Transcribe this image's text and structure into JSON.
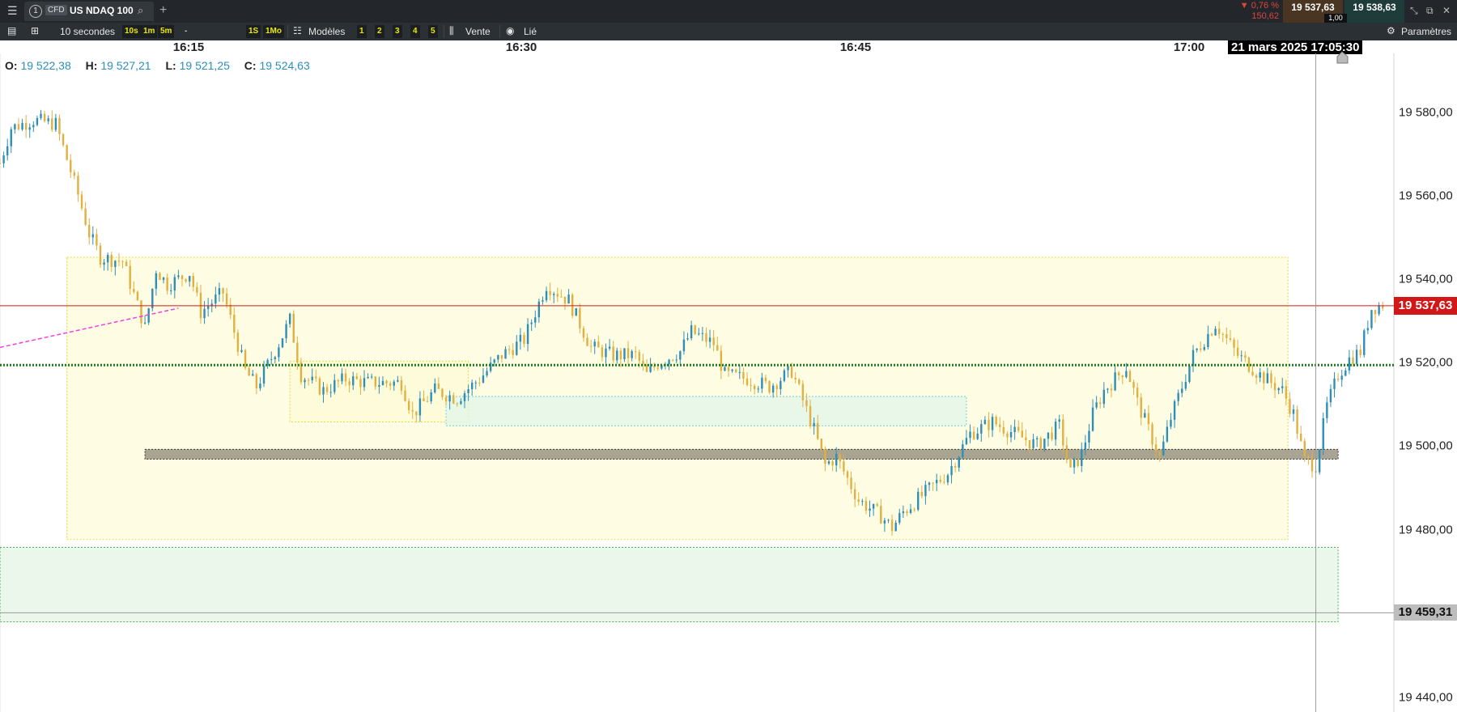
{
  "topbar": {
    "menu_icon": "hamburger-icon",
    "tab_number": "1",
    "tab_badge": "CFD",
    "instrument": "US NDAQ 100",
    "search_icon": "search-icon",
    "add_icon": "plus-icon",
    "change_pct": "▼ 0,76 %",
    "change_abs": "150,62",
    "bid": "19 537,63",
    "ask": "19 538,63",
    "spread": "1,00",
    "window_icons": [
      "minimize-icon",
      "popout-icon",
      "close-icon"
    ]
  },
  "toolbar": {
    "timeframe": "10 secondes",
    "quick_intervals": [
      "10s",
      "1m",
      "5m"
    ],
    "dash": "-",
    "range_buttons": [
      "1S",
      "1Mo"
    ],
    "templates_label": "Modèles",
    "template_numbers": [
      "1",
      "2",
      "3",
      "4",
      "5"
    ],
    "sell_label": "Vente",
    "linked_label": "Lié",
    "settings_label": "Paramètres"
  },
  "time_axis": {
    "ticks": [
      "16:15",
      "16:30",
      "16:45",
      "17:00"
    ],
    "cursor_label": "21 mars 2025 17:05:30"
  },
  "ohlc": {
    "O": "19 522,38",
    "H": "19 527,21",
    "L": "19 521,25",
    "C": "19 524,63"
  },
  "colors": {
    "up": "#2d8fb8",
    "down": "#e0b040",
    "current_price_bg": "#d01818",
    "dotted_level": "#1e7a1e",
    "yellow_zone": "#fefbd8",
    "green_zone": "#e6f4e6"
  },
  "price_axis": {
    "labels": [
      "19 580,00",
      "19 560,00",
      "19 540,00",
      "19 520,00",
      "19 500,00",
      "19 480,00",
      "19 440,00"
    ],
    "current_price": "19 537,63",
    "hover_price": "19 459,31"
  },
  "chart_data": {
    "type": "candlestick",
    "x_start": "16:06:30",
    "x_end": "17:09:00",
    "ylim": [
      19434,
      19602
    ],
    "current_price": 19537.63,
    "hover_price": 19459.31,
    "dotted_level": 19522.5,
    "zones": [
      {
        "kind": "yellow",
        "from": "16:09:30",
        "to": "17:04:15",
        "low": 19478,
        "high": 19550
      },
      {
        "kind": "yellow",
        "from": "16:19:30",
        "to": "16:27:30",
        "low": 19508,
        "high": 19523.5
      },
      {
        "kind": "cyan",
        "from": "16:26:30",
        "to": "16:49:50",
        "low": 19507,
        "high": 19514.5
      },
      {
        "kind": "grey",
        "from": "16:13:00",
        "to": "17:06:30",
        "low": 19498.5,
        "high": 19501
      },
      {
        "kind": "green",
        "from": "16:06:30",
        "to": "17:06:30",
        "low": 19457,
        "high": 19476
      }
    ],
    "trend_line": {
      "from": [
        "16:06:30",
        19527
      ],
      "to": [
        "16:14:30",
        19537
      ]
    },
    "path": [
      [
        "16:06:30",
        19574
      ],
      [
        "16:07:00",
        19583
      ],
      [
        "16:08:00",
        19585
      ],
      [
        "16:09:00",
        19584
      ],
      [
        "16:10:00",
        19566
      ],
      [
        "16:10:30",
        19556
      ],
      [
        "16:11:00",
        19550
      ],
      [
        "16:12:00",
        19549
      ],
      [
        "16:13:00",
        19532
      ],
      [
        "16:13:30",
        19547
      ],
      [
        "16:14:00",
        19543
      ],
      [
        "16:15:00",
        19546
      ],
      [
        "16:15:30",
        19536
      ],
      [
        "16:16:30",
        19541
      ],
      [
        "16:17:30",
        19521
      ],
      [
        "16:18:00",
        19517
      ],
      [
        "16:19:00",
        19528
      ],
      [
        "16:19:30",
        19534
      ],
      [
        "16:20:00",
        19520
      ],
      [
        "16:21:00",
        19516
      ],
      [
        "16:22:00",
        19519
      ],
      [
        "16:23:00",
        19518
      ],
      [
        "16:24:30",
        19518
      ],
      [
        "16:25:00",
        19510
      ],
      [
        "16:26:00",
        19516
      ],
      [
        "16:27:00",
        19514
      ],
      [
        "16:28:00",
        19519
      ],
      [
        "16:29:00",
        19525
      ],
      [
        "16:30:00",
        19529
      ],
      [
        "16:31:00",
        19543
      ],
      [
        "16:32:00",
        19539
      ],
      [
        "16:33:00",
        19527
      ],
      [
        "16:34:00",
        19525
      ],
      [
        "16:35:00",
        19525
      ],
      [
        "16:35:30",
        19520
      ],
      [
        "16:36:00",
        19523
      ],
      [
        "16:37:00",
        19526
      ],
      [
        "16:37:30",
        19531
      ],
      [
        "16:38:30",
        19528
      ],
      [
        "16:39:00",
        19520
      ],
      [
        "16:40:00",
        19519
      ],
      [
        "16:41:00",
        19517
      ],
      [
        "16:42:00",
        19521
      ],
      [
        "16:43:00",
        19506
      ],
      [
        "16:43:30",
        19497
      ],
      [
        "16:44:00",
        19499
      ],
      [
        "16:45:00",
        19488
      ],
      [
        "16:46:00",
        19484
      ],
      [
        "16:46:30",
        19481
      ],
      [
        "16:47:00",
        19485
      ],
      [
        "16:48:00",
        19490
      ],
      [
        "16:49:00",
        19495
      ],
      [
        "16:49:30",
        19500
      ],
      [
        "16:50:00",
        19505
      ],
      [
        "16:51:00",
        19508
      ],
      [
        "16:52:00",
        19505
      ],
      [
        "16:53:00",
        19502
      ],
      [
        "16:54:00",
        19507
      ],
      [
        "16:54:30",
        19495
      ],
      [
        "16:55:00",
        19500
      ],
      [
        "16:55:30",
        19510
      ],
      [
        "16:56:00",
        19516
      ],
      [
        "16:57:00",
        19522
      ],
      [
        "16:57:30",
        19513
      ],
      [
        "16:58:30",
        19499
      ],
      [
        "16:59:00",
        19509
      ],
      [
        "17:00:00",
        19525
      ],
      [
        "17:01:00",
        19533
      ],
      [
        "17:02:00",
        19525
      ],
      [
        "17:03:00",
        19520
      ],
      [
        "17:04:00",
        19516
      ],
      [
        "17:04:30",
        19510
      ],
      [
        "17:05:00",
        19498
      ],
      [
        "17:05:30",
        19497
      ],
      [
        "17:06:00",
        19512
      ],
      [
        "17:06:30",
        19520
      ],
      [
        "17:07:00",
        19524
      ],
      [
        "17:07:30",
        19526
      ],
      [
        "17:08:00",
        19537
      ],
      [
        "17:08:30",
        19538
      ]
    ]
  }
}
